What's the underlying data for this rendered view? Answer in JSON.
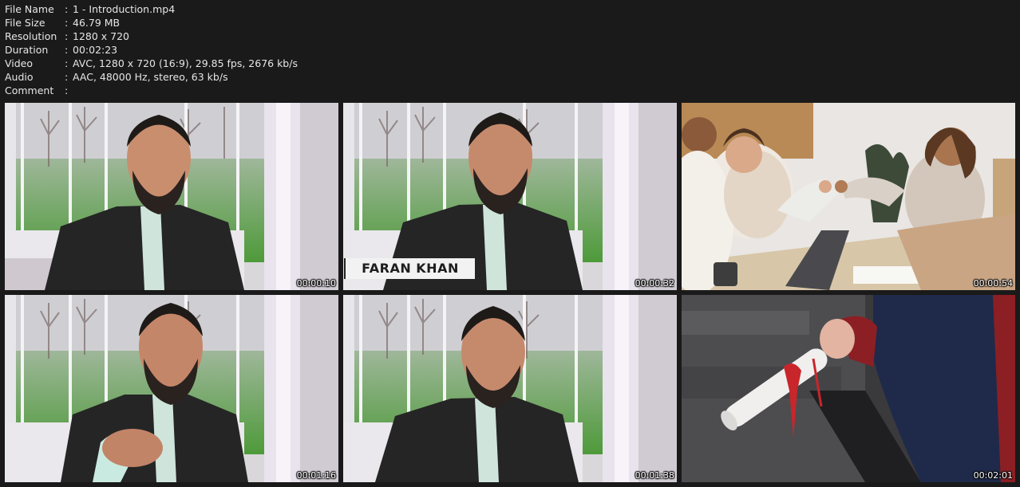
{
  "metadata": [
    {
      "key": "File Name",
      "value": "1 - Introduction.mp4"
    },
    {
      "key": "File Size",
      "value": "46.79 MB"
    },
    {
      "key": "Resolution",
      "value": "1280 x 720"
    },
    {
      "key": "Duration",
      "value": "00:02:23"
    },
    {
      "key": "Video",
      "value": "AVC, 1280 x 720 (16:9), 29.85 fps, 2676 kb/s"
    },
    {
      "key": "Audio",
      "value": "AAC, 48000 Hz, stereo, 63 kb/s"
    },
    {
      "key": "Comment",
      "value": ""
    }
  ],
  "separator": ":",
  "thumbnails": [
    {
      "timestamp": "00:00:10",
      "scene": "presenter-speaking"
    },
    {
      "timestamp": "00:00:32",
      "scene": "presenter-lower-third",
      "overlay": "FARAN KHAN"
    },
    {
      "timestamp": "00:00:54",
      "scene": "office-handshake"
    },
    {
      "timestamp": "00:01:16",
      "scene": "presenter-gesturing"
    },
    {
      "timestamp": "00:01:38",
      "scene": "presenter-speaking"
    },
    {
      "timestamp": "00:02:01",
      "scene": "diploma-handover"
    }
  ]
}
